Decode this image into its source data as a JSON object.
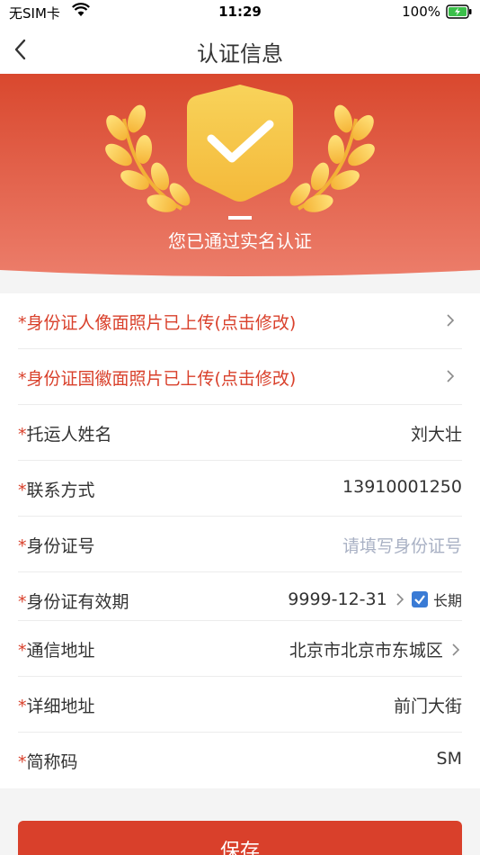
{
  "status": {
    "carrier": "无SIM卡",
    "time": "11:29",
    "battery": "100%"
  },
  "nav": {
    "title": "认证信息"
  },
  "hero": {
    "text": "您已通过实名认证"
  },
  "form": {
    "rows": [
      {
        "label": "*身份证人像面照片已上传(点击修改)"
      },
      {
        "label": "*身份证国徽面照片已上传(点击修改)"
      },
      {
        "label": "托运人姓名",
        "value": "刘大壮"
      },
      {
        "label": "联系方式",
        "value": "13910001250"
      },
      {
        "label": "身份证号",
        "placeholder": "请填写身份证号"
      },
      {
        "label": "身份证有效期",
        "value": "9999-12-31",
        "checkbox_label": "长期",
        "checkbox_checked": true
      },
      {
        "label": "通信地址",
        "value": "北京市北京市东城区"
      },
      {
        "label": "详细地址",
        "value": "前门大街"
      },
      {
        "label": "简称码",
        "value": "SM"
      }
    ],
    "required_mark": "*"
  },
  "footer": {
    "save_label": "保存"
  },
  "colors": {
    "accent": "#d9402b",
    "hero_top": "#d9482e",
    "hero_bottom": "#ec7d6a",
    "badge": "#f6c343",
    "placeholder": "#a9b1c4",
    "checkbox": "#3a7bd5"
  }
}
